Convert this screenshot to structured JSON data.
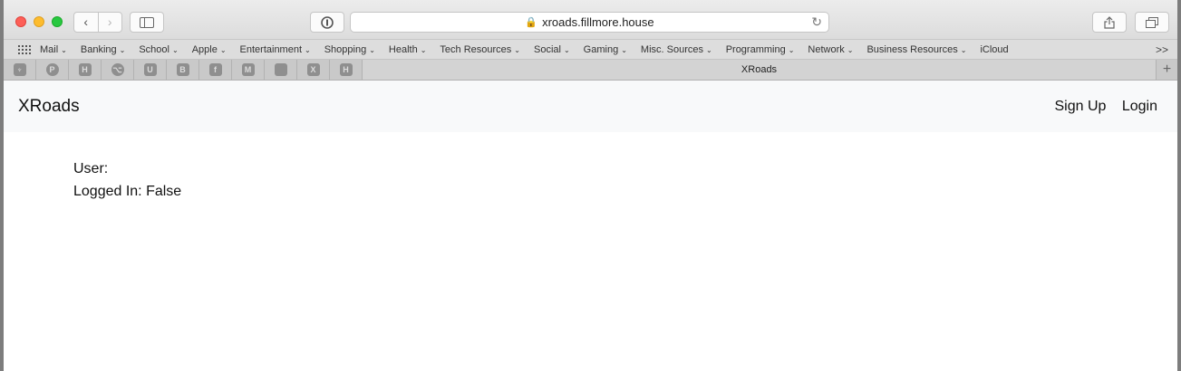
{
  "browser": {
    "url": "xroads.fillmore.house",
    "bookmarks": [
      {
        "label": "Mail"
      },
      {
        "label": "Banking"
      },
      {
        "label": "School"
      },
      {
        "label": "Apple"
      },
      {
        "label": "Entertainment"
      },
      {
        "label": "Shopping"
      },
      {
        "label": "Health"
      },
      {
        "label": "Tech Resources"
      },
      {
        "label": "Social"
      },
      {
        "label": "Gaming"
      },
      {
        "label": "Misc. Sources"
      },
      {
        "label": "Programming"
      },
      {
        "label": "Network"
      },
      {
        "label": "Business Resources"
      }
    ],
    "icloud": "iCloud",
    "more": ">>",
    "pinned_tabs": [
      {
        "icon": "tree-icon",
        "glyph": "♆"
      },
      {
        "icon": "pinterest-icon",
        "glyph": "P"
      },
      {
        "icon": "hippo-icon",
        "glyph": "H"
      },
      {
        "icon": "github-icon",
        "glyph": "⌥"
      },
      {
        "icon": "u-icon",
        "glyph": "U"
      },
      {
        "icon": "b-icon",
        "glyph": "B"
      },
      {
        "icon": "facebook-icon",
        "glyph": "f"
      },
      {
        "icon": "m-icon",
        "glyph": "M"
      },
      {
        "icon": "apple-icon",
        "glyph": ""
      },
      {
        "icon": "x-icon",
        "glyph": "X"
      },
      {
        "icon": "h-icon",
        "glyph": "H"
      }
    ],
    "active_tab": "XRoads"
  },
  "site": {
    "brand": "XRoads",
    "nav": {
      "signup": "Sign Up",
      "login": "Login"
    },
    "user_label": "User:",
    "logged_in_label": "Logged In: False"
  }
}
